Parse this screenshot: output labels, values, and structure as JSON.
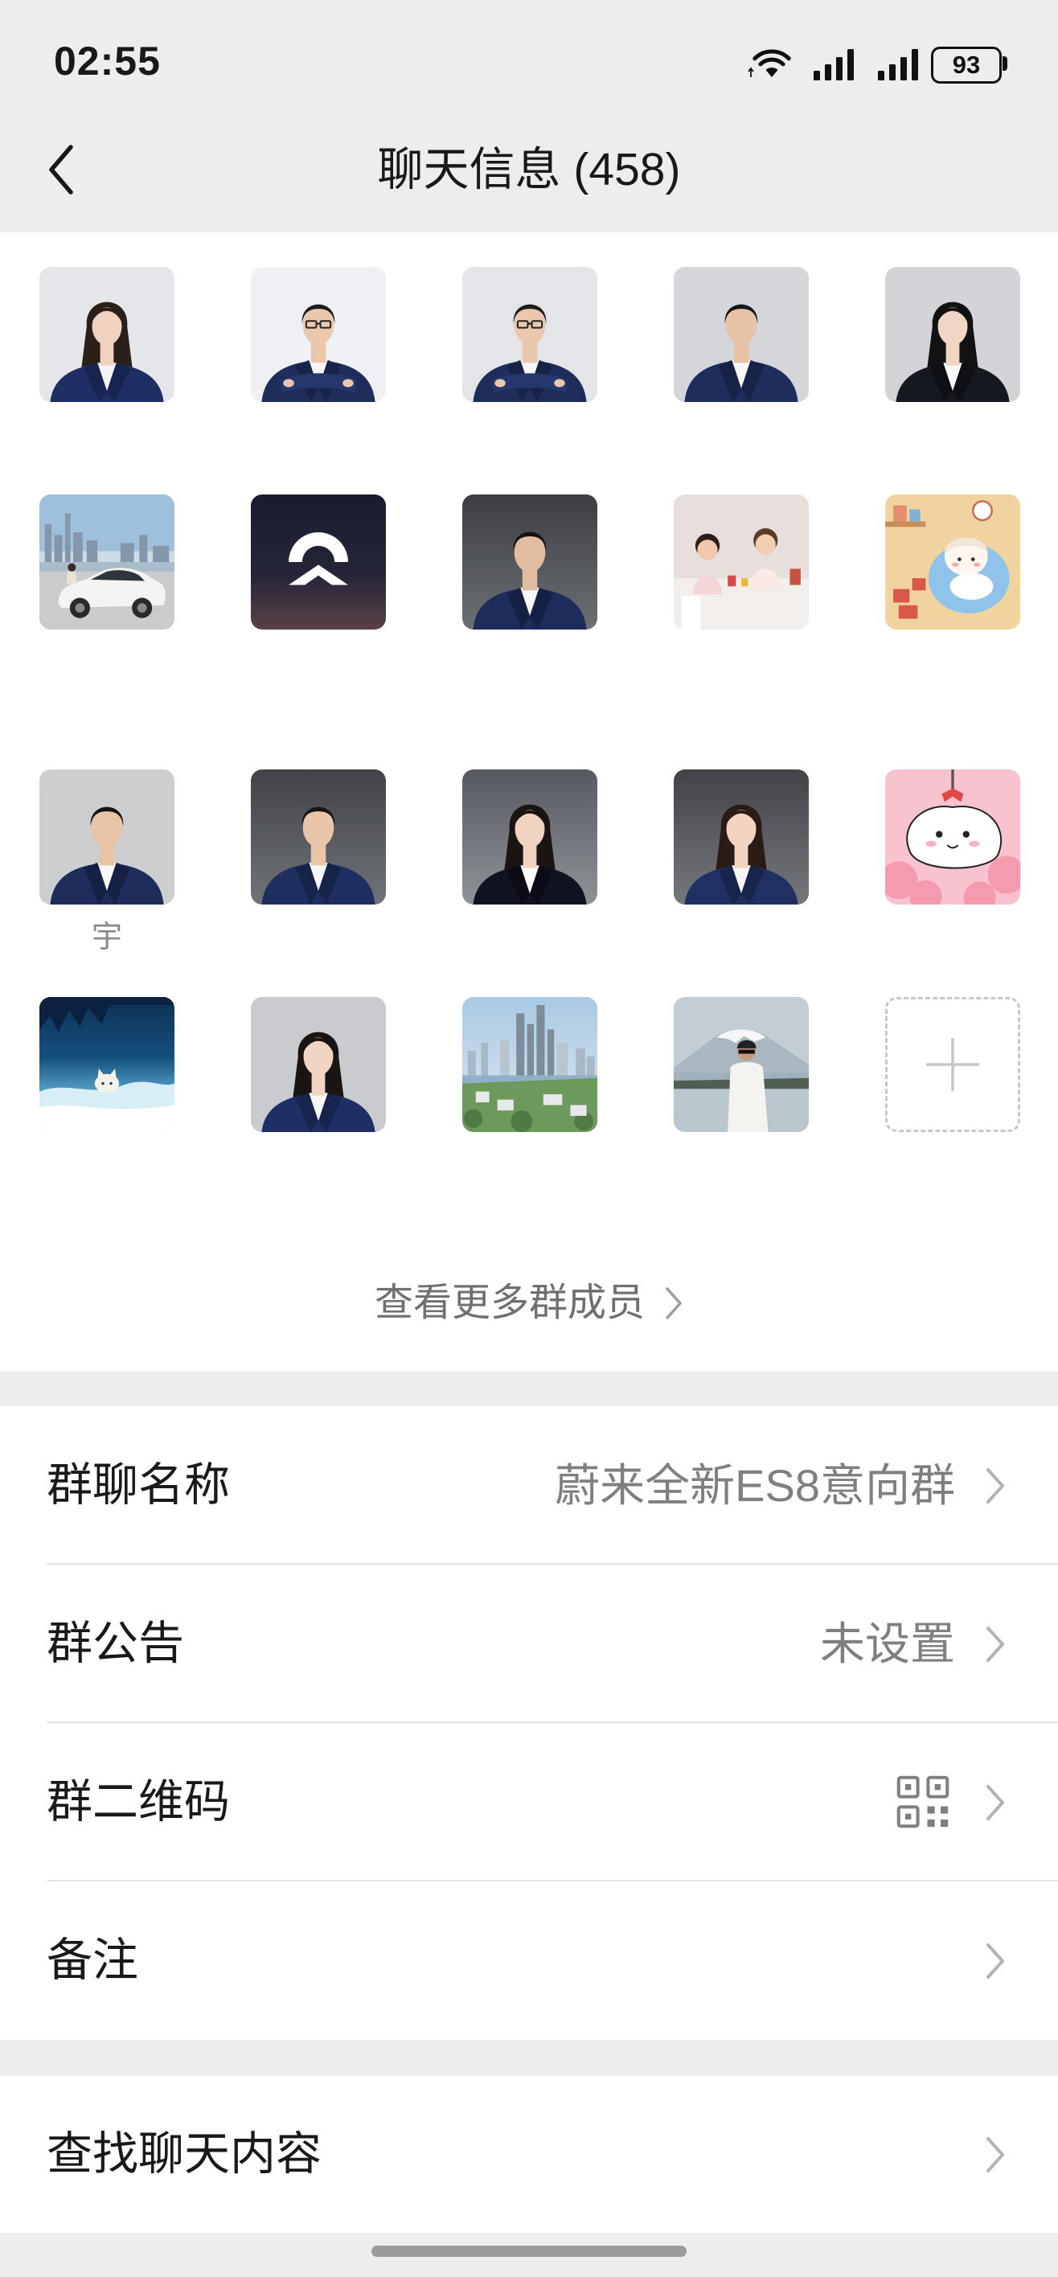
{
  "status_bar": {
    "time": "02:55",
    "battery_level": "93",
    "icons": [
      "wifi-icon",
      "signal-icon",
      "signal-icon",
      "battery-icon"
    ]
  },
  "header": {
    "title": "聊天信息 (458)",
    "back_icon": "chevron-left-icon"
  },
  "members": {
    "items": [
      {
        "name": ""
      },
      {
        "name": ""
      },
      {
        "name": ""
      },
      {
        "name": ""
      },
      {
        "name": ""
      },
      {
        "name": ""
      },
      {
        "name": ""
      },
      {
        "name": ""
      },
      {
        "name": ""
      },
      {
        "name": ""
      },
      {
        "name": "宇"
      },
      {
        "name": ""
      },
      {
        "name": ""
      },
      {
        "name": ""
      },
      {
        "name": ""
      },
      {
        "name": ""
      },
      {
        "name": ""
      },
      {
        "name": ""
      },
      {
        "name": ""
      }
    ],
    "add_member_icon": "plus-icon",
    "view_more_label": "查看更多群成员",
    "view_more_icon": "chevron-right-icon"
  },
  "settings": {
    "group_name": {
      "label": "群聊名称",
      "value": "蔚来全新ES8意向群"
    },
    "announcement": {
      "label": "群公告",
      "value": "未设置"
    },
    "qr_code": {
      "label": "群二维码",
      "icon": "qr-code-icon"
    },
    "remark": {
      "label": "备注"
    }
  },
  "search_chat": {
    "label": "查找聊天内容"
  },
  "colors": {
    "page_background": "#ededed",
    "surface": "#ffffff",
    "primary_text": "#191919",
    "secondary_text": "#7f7f7f",
    "chevron": "#b3b3b3"
  }
}
